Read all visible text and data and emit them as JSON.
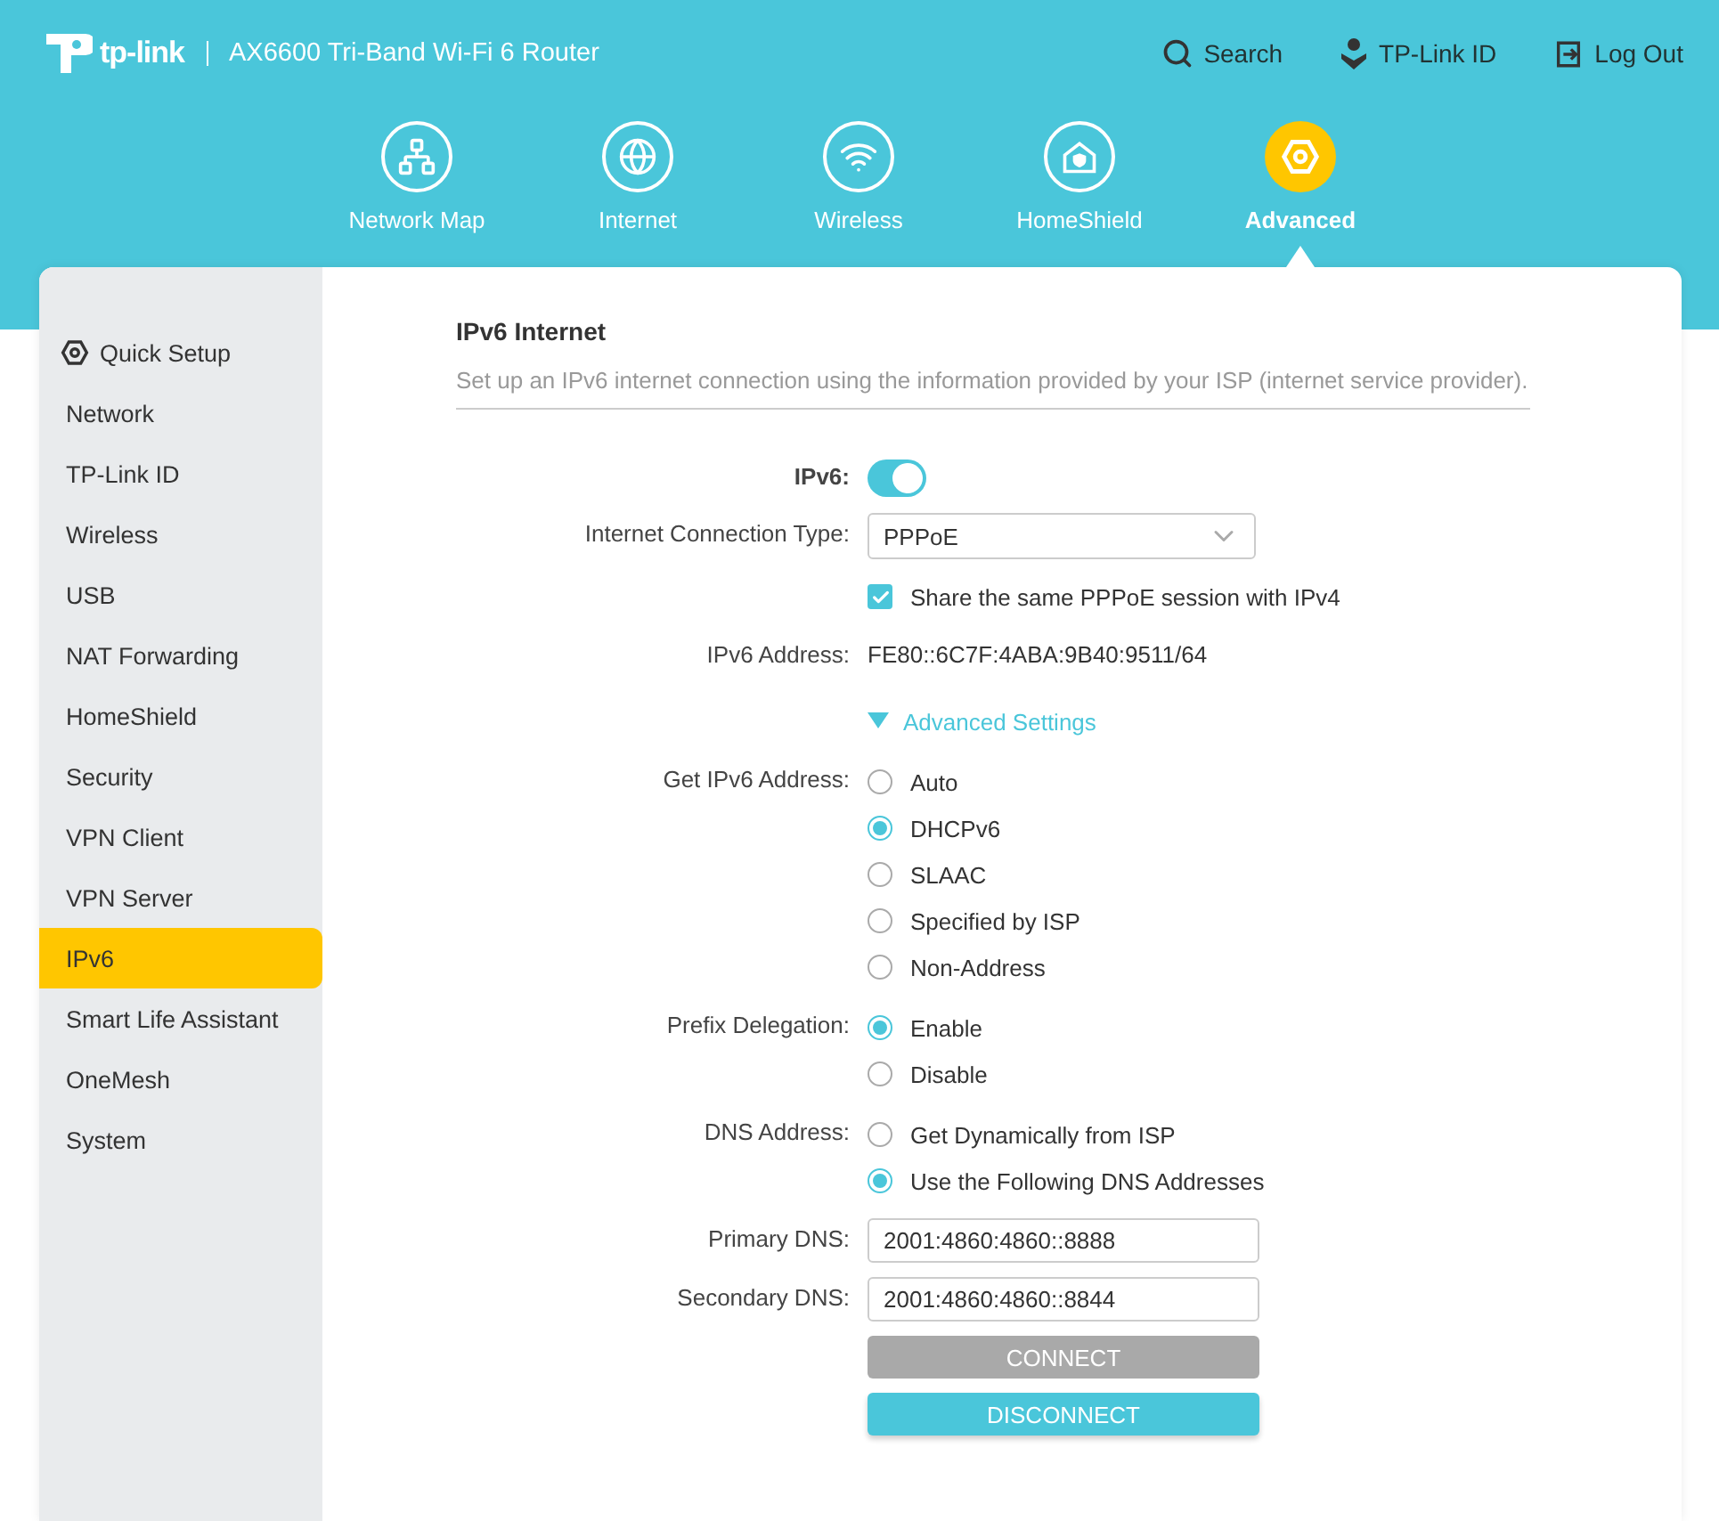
{
  "header": {
    "logo_text": "tp-link",
    "model": "AX6600 Tri-Band Wi-Fi 6 Router",
    "links": [
      {
        "kind": "search",
        "label": "Search"
      },
      {
        "kind": "account",
        "label": "TP-Link ID"
      },
      {
        "kind": "logout",
        "label": "Log Out"
      }
    ]
  },
  "nav": [
    {
      "kind": "network-map",
      "label": "Network Map",
      "selected": false
    },
    {
      "kind": "internet",
      "label": "Internet",
      "selected": false
    },
    {
      "kind": "wireless",
      "label": "Wireless",
      "selected": false
    },
    {
      "kind": "homeshield",
      "label": "HomeShield",
      "selected": false
    },
    {
      "kind": "advanced",
      "label": "Advanced",
      "selected": true
    }
  ],
  "sidebar": {
    "items": [
      {
        "label": "Quick Setup",
        "kind": "quick-setup",
        "selected": false
      },
      {
        "label": "Network",
        "selected": false
      },
      {
        "label": "TP-Link ID",
        "selected": false
      },
      {
        "label": "Wireless",
        "selected": false
      },
      {
        "label": "USB",
        "selected": false
      },
      {
        "label": "NAT Forwarding",
        "selected": false
      },
      {
        "label": "HomeShield",
        "selected": false
      },
      {
        "label": "Security",
        "selected": false
      },
      {
        "label": "VPN Client",
        "selected": false
      },
      {
        "label": "VPN Server",
        "selected": false
      },
      {
        "label": "IPv6",
        "selected": true
      },
      {
        "label": "Smart Life Assistant",
        "selected": false
      },
      {
        "label": "OneMesh",
        "selected": false
      },
      {
        "label": "System",
        "selected": false
      }
    ]
  },
  "section": {
    "title": "IPv6 Internet",
    "description": "Set up an IPv6 internet connection using the information provided by your ISP (internet service provider)."
  },
  "form": [
    {
      "kind": "toggle",
      "label": "IPv6:",
      "on": true
    },
    {
      "kind": "select",
      "label": "Internet Connection Type:",
      "value": "PPPoE"
    },
    {
      "kind": "checkbox",
      "text": "Share the same PPPoE session with IPv4",
      "checked": true
    },
    {
      "kind": "text",
      "label": "IPv6 Address:",
      "value": "FE80::6C7F:4ABA:9B40:9511/64"
    },
    {
      "kind": "expander",
      "text": "Advanced Settings",
      "expanded": true
    },
    {
      "kind": "radio",
      "label": "Get IPv6 Address:",
      "options": [
        {
          "label": "Auto",
          "selected": false
        },
        {
          "label": "DHCPv6",
          "selected": true
        },
        {
          "label": "SLAAC",
          "selected": false
        },
        {
          "label": "Specified by ISP",
          "selected": false
        },
        {
          "label": "Non-Address",
          "selected": false
        }
      ]
    },
    {
      "kind": "radio",
      "label": "Prefix Delegation:",
      "options": [
        {
          "label": "Enable",
          "selected": true
        },
        {
          "label": "Disable",
          "selected": false
        }
      ]
    },
    {
      "kind": "radio",
      "label": "DNS Address:",
      "options": [
        {
          "label": "Get Dynamically from ISP",
          "selected": false
        },
        {
          "label": "Use the Following DNS Addresses",
          "selected": true
        }
      ]
    },
    {
      "kind": "input",
      "label": "Primary DNS:",
      "value": "2001:4860:4860::8888"
    },
    {
      "kind": "input",
      "label": "Secondary DNS:",
      "value": "2001:4860:4860::8844"
    }
  ],
  "buttons": [
    {
      "label": "CONNECT",
      "disabled": true
    },
    {
      "label": "DISCONNECT",
      "disabled": false
    }
  ]
}
